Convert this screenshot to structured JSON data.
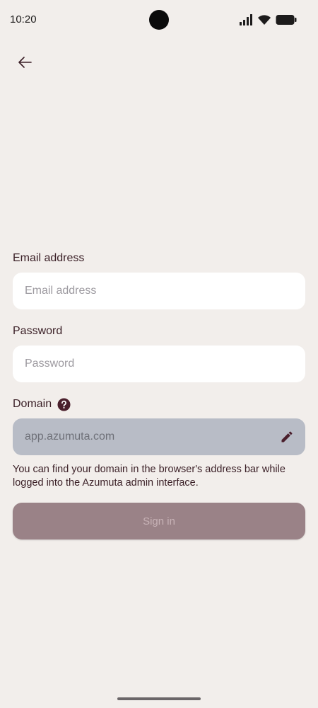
{
  "status_bar": {
    "time": "10:20",
    "icons": [
      "signal-icon",
      "wifi-icon",
      "battery-icon"
    ]
  },
  "nav": {
    "back_icon": "arrow-left-icon"
  },
  "form": {
    "email_label": "Email address",
    "email_placeholder": "Email address",
    "email_value": "",
    "password_label": "Password",
    "password_placeholder": "Password",
    "password_value": "",
    "domain_label": "Domain",
    "domain_help_icon": "question-circle-icon",
    "domain_value": "app.azumuta.com",
    "domain_edit_icon": "pencil-icon",
    "domain_help_text": "You can find your domain in the browser's address bar while logged into the Azumuta admin interface.",
    "sign_in_label": "Sign in"
  },
  "colors": {
    "background": "#f2eeeb",
    "text": "#3a1f26",
    "field_bg": "#ffffff",
    "domain_field_bg": "#b8bcc6",
    "button_disabled_bg": "#9a8287",
    "button_disabled_text": "#c7b2b6"
  }
}
